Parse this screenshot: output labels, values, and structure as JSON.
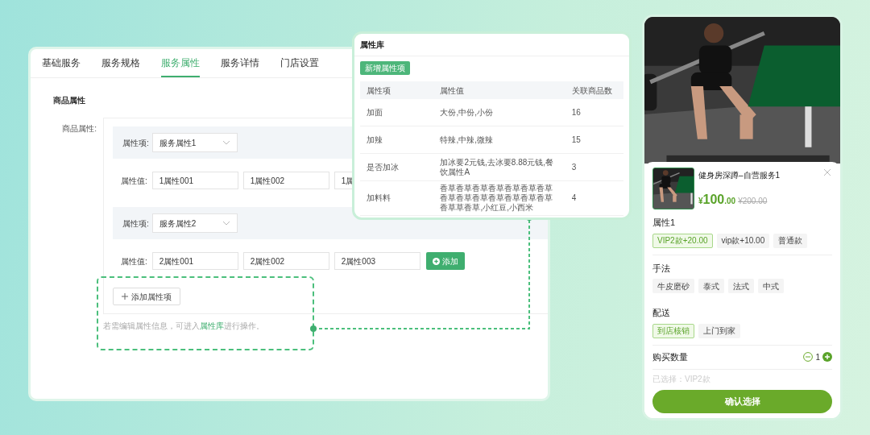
{
  "editor": {
    "tabs": [
      {
        "label": "基础服务",
        "selected": false
      },
      {
        "label": "服务规格",
        "selected": false
      },
      {
        "label": "服务属性",
        "selected": true
      },
      {
        "label": "服务详情",
        "selected": false
      },
      {
        "label": "门店设置",
        "selected": false
      }
    ],
    "section_title": "商品属性",
    "field_label": "商品属性:",
    "groups": [
      {
        "item_label": "属性项:",
        "item_value": "服务属性1",
        "values_label": "属性值:",
        "values": [
          "1属性001",
          "1属性002",
          "1属"
        ]
      },
      {
        "item_label": "属性项:",
        "item_value": "服务属性2",
        "values_label": "属性值:",
        "values": [
          "2属性001",
          "2属性002",
          "2属性003"
        ],
        "add_button": "添加"
      }
    ],
    "add_item_button": "添加属性项",
    "hint": "若需编辑属性信息，可进入",
    "hint_link": "属性库",
    "hint_tail": "进行操作。"
  },
  "library": {
    "title": "属性库",
    "new_button": "新增属性项",
    "columns": [
      "属性项",
      "属性值",
      "关联商品数"
    ],
    "rows": [
      [
        "加面",
        "大份,中份,小份",
        "16"
      ],
      [
        "加辣",
        "特辣,中辣,微辣",
        "15"
      ],
      [
        "是否加冰",
        "加冰要2元钱,去冰要8.88元钱,餐饮属性A",
        "3"
      ],
      [
        "加料料",
        "香草香草香草香草香草香草香草香草香草香草香草香草香草香草香草草香草,小红豆,小西米",
        "4"
      ]
    ]
  },
  "sheet": {
    "title": "健身房深蹲–自营服务1",
    "price_symbol": "¥",
    "price_int": "100",
    "price_dec": ".00",
    "old_price": "¥200.00",
    "groups": [
      {
        "label": "属性1",
        "options": [
          {
            "label": "VIP2款+20.00",
            "selected": true
          },
          {
            "label": "vip款+10.00",
            "selected": false
          },
          {
            "label": "普通款",
            "selected": false
          }
        ]
      },
      {
        "label": "手法",
        "options": [
          {
            "label": "牛皮磨砂",
            "selected": false
          },
          {
            "label": "泰式",
            "selected": false
          },
          {
            "label": "法式",
            "selected": false
          },
          {
            "label": "中式",
            "selected": false
          }
        ]
      },
      {
        "label": "配送",
        "options": [
          {
            "label": "到店核销",
            "selected": true
          },
          {
            "label": "上门到家",
            "selected": false
          }
        ]
      }
    ],
    "quantity_label": "购买数量",
    "quantity": "1",
    "selected_summary": "已选择：VIP2款",
    "confirm_button": "确认选择"
  }
}
